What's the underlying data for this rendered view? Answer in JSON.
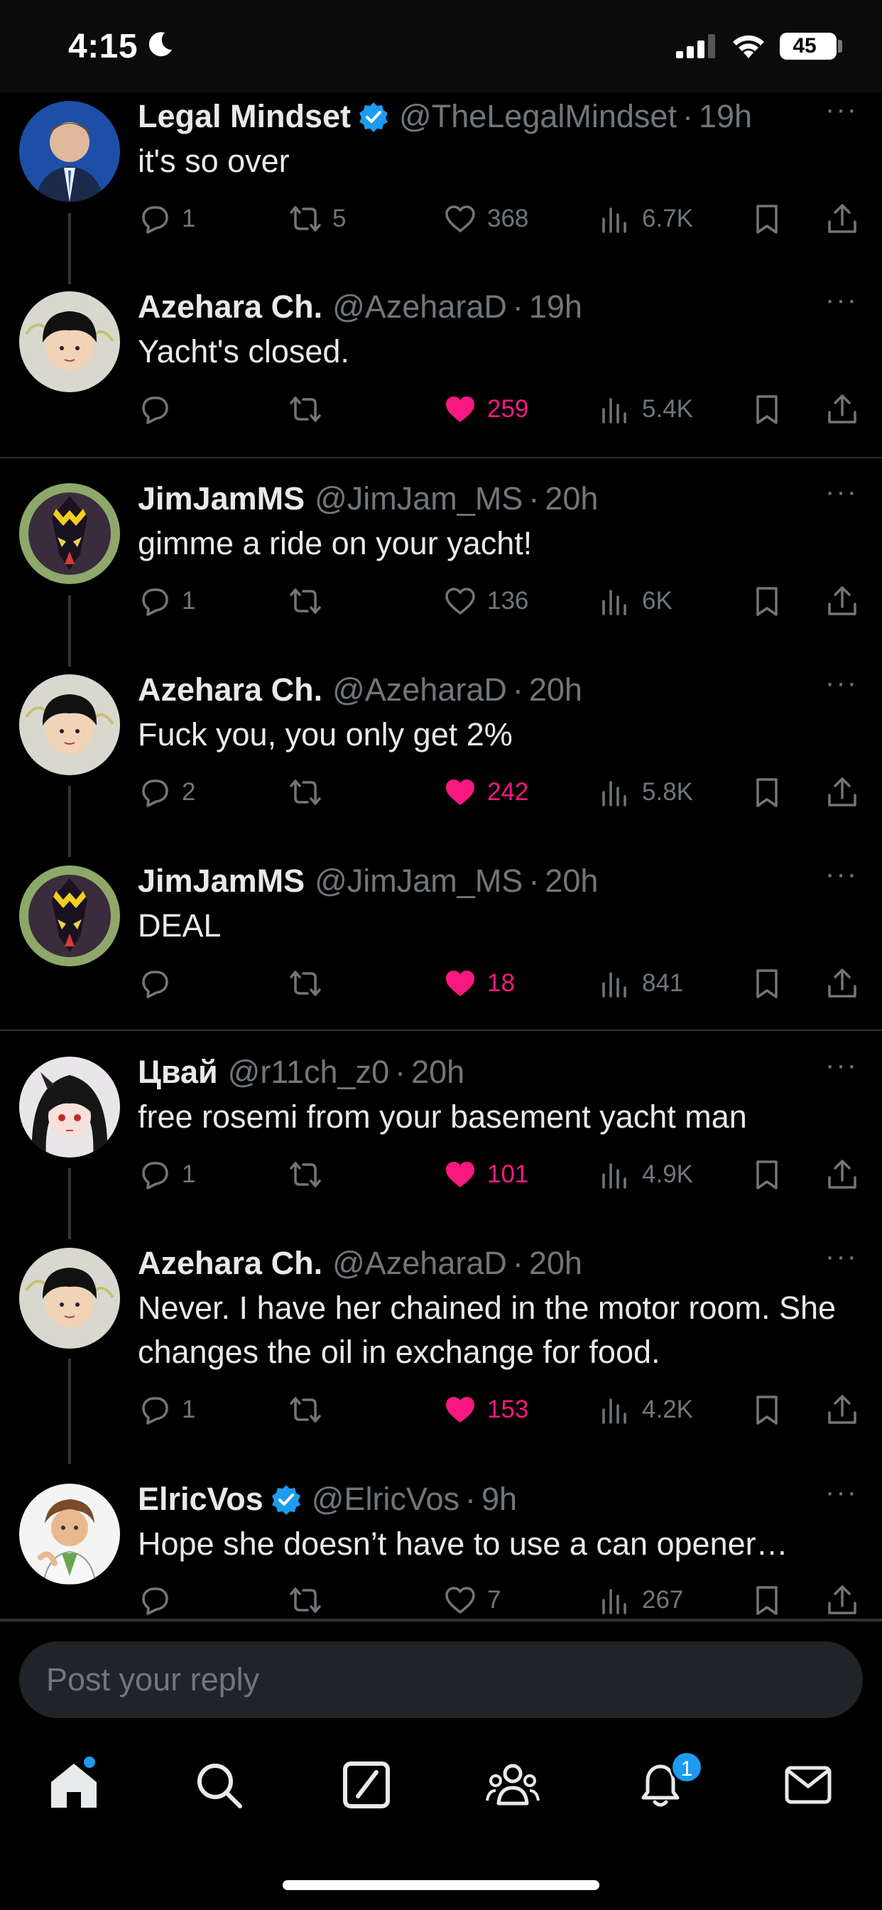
{
  "status_bar": {
    "time": "4:15",
    "battery": "45"
  },
  "colors": {
    "accent": "#1d9bf0",
    "like": "#f91880",
    "muted": "#71767b",
    "text": "#e7e9ea"
  },
  "posts": [
    {
      "name": "Legal Mindset",
      "verified": true,
      "handle": "@TheLegalMindset",
      "time": "19h",
      "text": "it's so over",
      "replies": "1",
      "reposts": "5",
      "likes": "368",
      "liked": false,
      "views": "6.7K"
    },
    {
      "name": "Azehara Ch.",
      "verified": false,
      "handle": "@AzeharaD",
      "time": "19h",
      "text": "Yacht's closed.",
      "replies": "",
      "reposts": "",
      "likes": "259",
      "liked": true,
      "views": "5.4K"
    },
    {
      "name": "JimJamMS",
      "verified": false,
      "handle": "@JimJam_MS",
      "time": "20h",
      "text": "gimme a ride on your yacht!",
      "replies": "1",
      "reposts": "",
      "likes": "136",
      "liked": false,
      "views": "6K"
    },
    {
      "name": "Azehara Ch.",
      "verified": false,
      "handle": "@AzeharaD",
      "time": "20h",
      "text": "Fuck you, you only get 2%",
      "replies": "2",
      "reposts": "",
      "likes": "242",
      "liked": true,
      "views": "5.8K"
    },
    {
      "name": "JimJamMS",
      "verified": false,
      "handle": "@JimJam_MS",
      "time": "20h",
      "text": "DEAL",
      "replies": "",
      "reposts": "",
      "likes": "18",
      "liked": true,
      "views": "841"
    },
    {
      "name": "Цвай",
      "verified": false,
      "handle": "@r11ch_z0",
      "time": "20h",
      "text": "free rosemi from your basement yacht man",
      "replies": "1",
      "reposts": "",
      "likes": "101",
      "liked": true,
      "views": "4.9K"
    },
    {
      "name": "Azehara Ch.",
      "verified": false,
      "handle": "@AzeharaD",
      "time": "20h",
      "text": "Never.  I have her chained in the motor room. She changes the oil in exchange for food.",
      "replies": "1",
      "reposts": "",
      "likes": "153",
      "liked": true,
      "views": "4.2K"
    },
    {
      "name": "ElricVos",
      "verified": true,
      "handle": "@ElricVos",
      "time": "9h",
      "text": "Hope she doesn’t have to use a can opener…",
      "replies": "",
      "reposts": "",
      "likes": "7",
      "liked": false,
      "views": "267"
    }
  ],
  "reply": {
    "placeholder": "Post your reply"
  },
  "nav": {
    "notifications_badge": "1",
    "icons": [
      "home-icon",
      "search-icon",
      "grok-icon",
      "communities-icon",
      "notifications-icon",
      "messages-icon"
    ]
  }
}
